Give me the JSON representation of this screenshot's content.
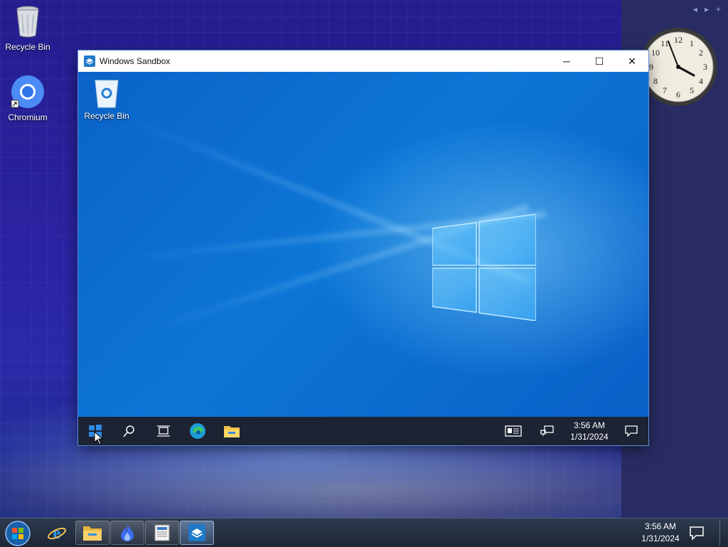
{
  "host": {
    "desktop_icons": [
      {
        "label": "Recycle Bin",
        "icon": "recycle-bin-icon"
      },
      {
        "label": "Chromium",
        "icon": "chromium-icon"
      }
    ],
    "gadget_controls": [
      "◂",
      "▸",
      "+"
    ],
    "clock_numbers": [
      "12",
      "1",
      "2",
      "3",
      "4",
      "5",
      "6",
      "7",
      "8",
      "9",
      "10",
      "11"
    ],
    "taskbar": {
      "time": "3:56 AM",
      "date": "1/31/2024",
      "buttons": [
        "start-orb-icon",
        "internet-explorer-icon",
        "file-explorer-icon",
        "app-flame-icon",
        "wordpad-icon",
        "windows-sandbox-icon"
      ]
    }
  },
  "sandbox": {
    "title": "Windows Sandbox",
    "controls": {
      "minimize": "─",
      "maximize": "☐",
      "close": "✕"
    },
    "desktop_icon": {
      "label": "Recycle Bin",
      "icon": "recycle-bin-icon"
    },
    "taskbar": {
      "buttons": [
        "windows-start-icon",
        "search-icon",
        "task-view-icon",
        "edge-icon",
        "file-explorer-icon"
      ],
      "time": "3:56 AM",
      "date": "1/31/2024"
    }
  },
  "colors": {
    "guest_accent": "#0c76d6",
    "guest_taskbar": "#1c2333",
    "host_desktop": "#241d8e"
  }
}
